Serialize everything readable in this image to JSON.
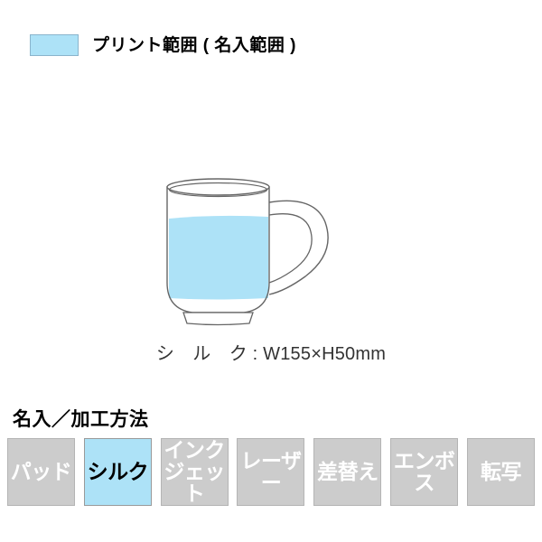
{
  "legend": {
    "swatch_icon": "print-area-swatch",
    "swatch_color": "#ade2f7",
    "label": "プリント範囲 ( 名入範囲 )"
  },
  "illustration": {
    "product_icon": "mug-outline",
    "print_area_color": "#ade2f7",
    "outline_color": "#666666"
  },
  "dimension": {
    "caption": "シ　ル　ク : W155×H50mm",
    "method": "シルク",
    "width_mm": "W155",
    "height_mm": "H50",
    "unit": "mm"
  },
  "methods": {
    "heading": "名入／加工方法",
    "active_color": "#ade2f7",
    "inactive_color": "#cccccc",
    "items": [
      {
        "label": "パッド",
        "active": false
      },
      {
        "label": "シルク",
        "active": true
      },
      {
        "label": "インクジェット",
        "active": false
      },
      {
        "label": "レーザー",
        "active": false
      },
      {
        "label": "差替え",
        "active": false
      },
      {
        "label": "エンボス",
        "active": false
      },
      {
        "label": "転写",
        "active": false
      }
    ]
  }
}
